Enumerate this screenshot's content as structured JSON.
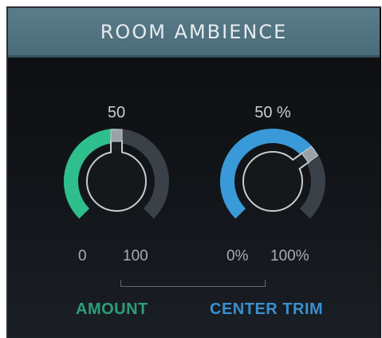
{
  "header": {
    "title": "ROOM AMBIENCE"
  },
  "knobs": [
    {
      "id": "amount",
      "name": "AMOUNT",
      "value_text": "50",
      "min_label": "0",
      "max_label": "100",
      "value_fraction": 0.5,
      "accent_color": "#2fbf8c"
    },
    {
      "id": "center_trim",
      "name": "CENTER TRIM",
      "value_text": "50 %",
      "min_label": "0%",
      "max_label": "100%",
      "value_fraction": 0.7,
      "accent_color": "#3a9ad9"
    }
  ],
  "colors": {
    "header_bg": "#4f7080",
    "panel_bg": "#101316",
    "track": "#3a4148",
    "amount": "#2fbf8c",
    "center_trim": "#3a9ad9",
    "label": "#c9cdd1"
  }
}
